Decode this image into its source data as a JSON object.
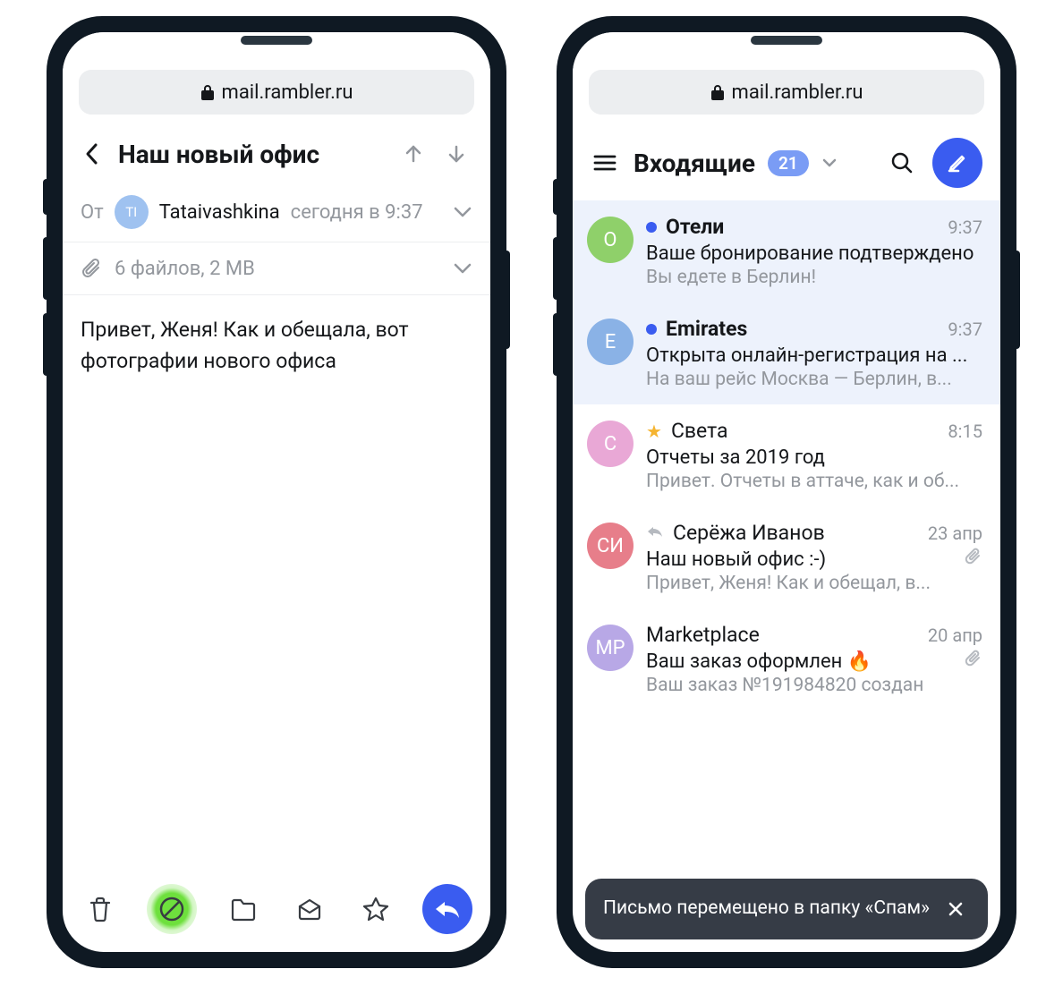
{
  "url_bar": {
    "domain": "mail.rambler.ru"
  },
  "message_view": {
    "title": "Наш новый офис",
    "from_label": "От",
    "avatar_initials": "TI",
    "avatar_color": "#9fc2f0",
    "sender_name": "Tataivashkina",
    "sent_time": "сегодня в 9:37",
    "attachments_text": "6 файлов, 2 MB",
    "body": "Привет, Женя! Как и обещала, вот фотографии нового офиса"
  },
  "inbox": {
    "folder_title": "Входящие",
    "unread_count": "21",
    "items": [
      {
        "avatar": "О",
        "avatar_color": "#8fd06a",
        "unread": true,
        "sender": "Отели",
        "time": "9:37",
        "subject": "Ваше бронирование подтверждено",
        "preview": "Вы едете в Берлин!",
        "selected": true
      },
      {
        "avatar": "E",
        "avatar_color": "#8ab2e6",
        "unread": true,
        "sender": "Emirates",
        "time": "9:37",
        "subject": "Открыта онлайн-регистрация на ...",
        "preview": "На ваш рейс Москва — Берлин, в...",
        "selected": true
      },
      {
        "avatar": "С",
        "avatar_color": "#e9a8d6",
        "starred": true,
        "sender": "Света",
        "time": "8:15",
        "subject": "Отчеты за 2019 год",
        "preview": "Привет. Отчеты в аттаче, как и об..."
      },
      {
        "avatar": "СИ",
        "avatar_color": "#e77e8a",
        "replied": true,
        "sender": "Серёжа Иванов",
        "time": "23 апр",
        "subject": "Наш новый офис :-)",
        "preview": "Привет, Женя! Как и обещал, в...",
        "has_attachment": true
      },
      {
        "avatar": "MP",
        "avatar_color": "#b8a8e6",
        "sender": "Marketplace",
        "time": "20 апр",
        "subject": "Ваш заказ оформлен 🔥",
        "preview": "Ваш заказ №191984820 создан",
        "has_attachment": true
      }
    ]
  },
  "toast": {
    "text": "Письмо перемещено в папку «Спам»"
  }
}
